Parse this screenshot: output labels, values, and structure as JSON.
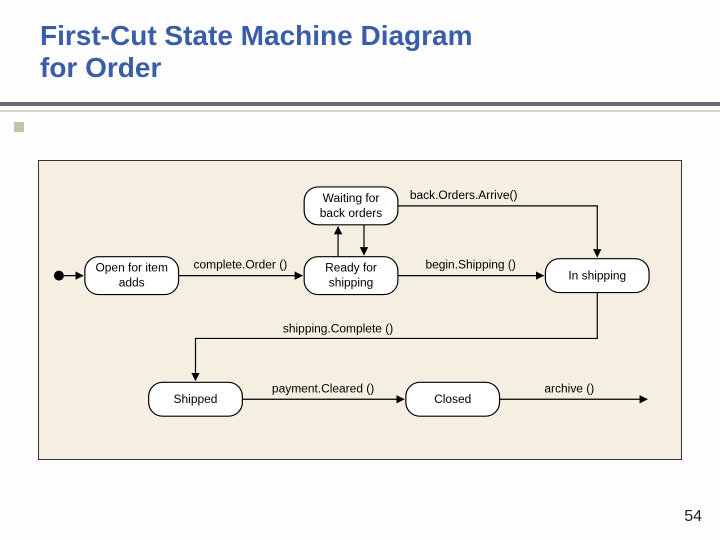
{
  "title_line1": "First-Cut State Machine Diagram",
  "title_line2": "for Order",
  "page_number": "54",
  "states": {
    "open": "Open for item adds",
    "waiting": "Waiting for back orders",
    "ready": "Ready for shipping",
    "inship": "In shipping",
    "shipped": "Shipped",
    "closed": "Closed"
  },
  "transitions": {
    "completeOrder": "complete.Order ()",
    "backOrdersArrive": "back.Orders.Arrive()",
    "beginShipping": "begin.Shipping ()",
    "shippingComplete": "shipping.Complete ()",
    "paymentCleared": "payment.Cleared ()",
    "archive": "archive ()"
  }
}
